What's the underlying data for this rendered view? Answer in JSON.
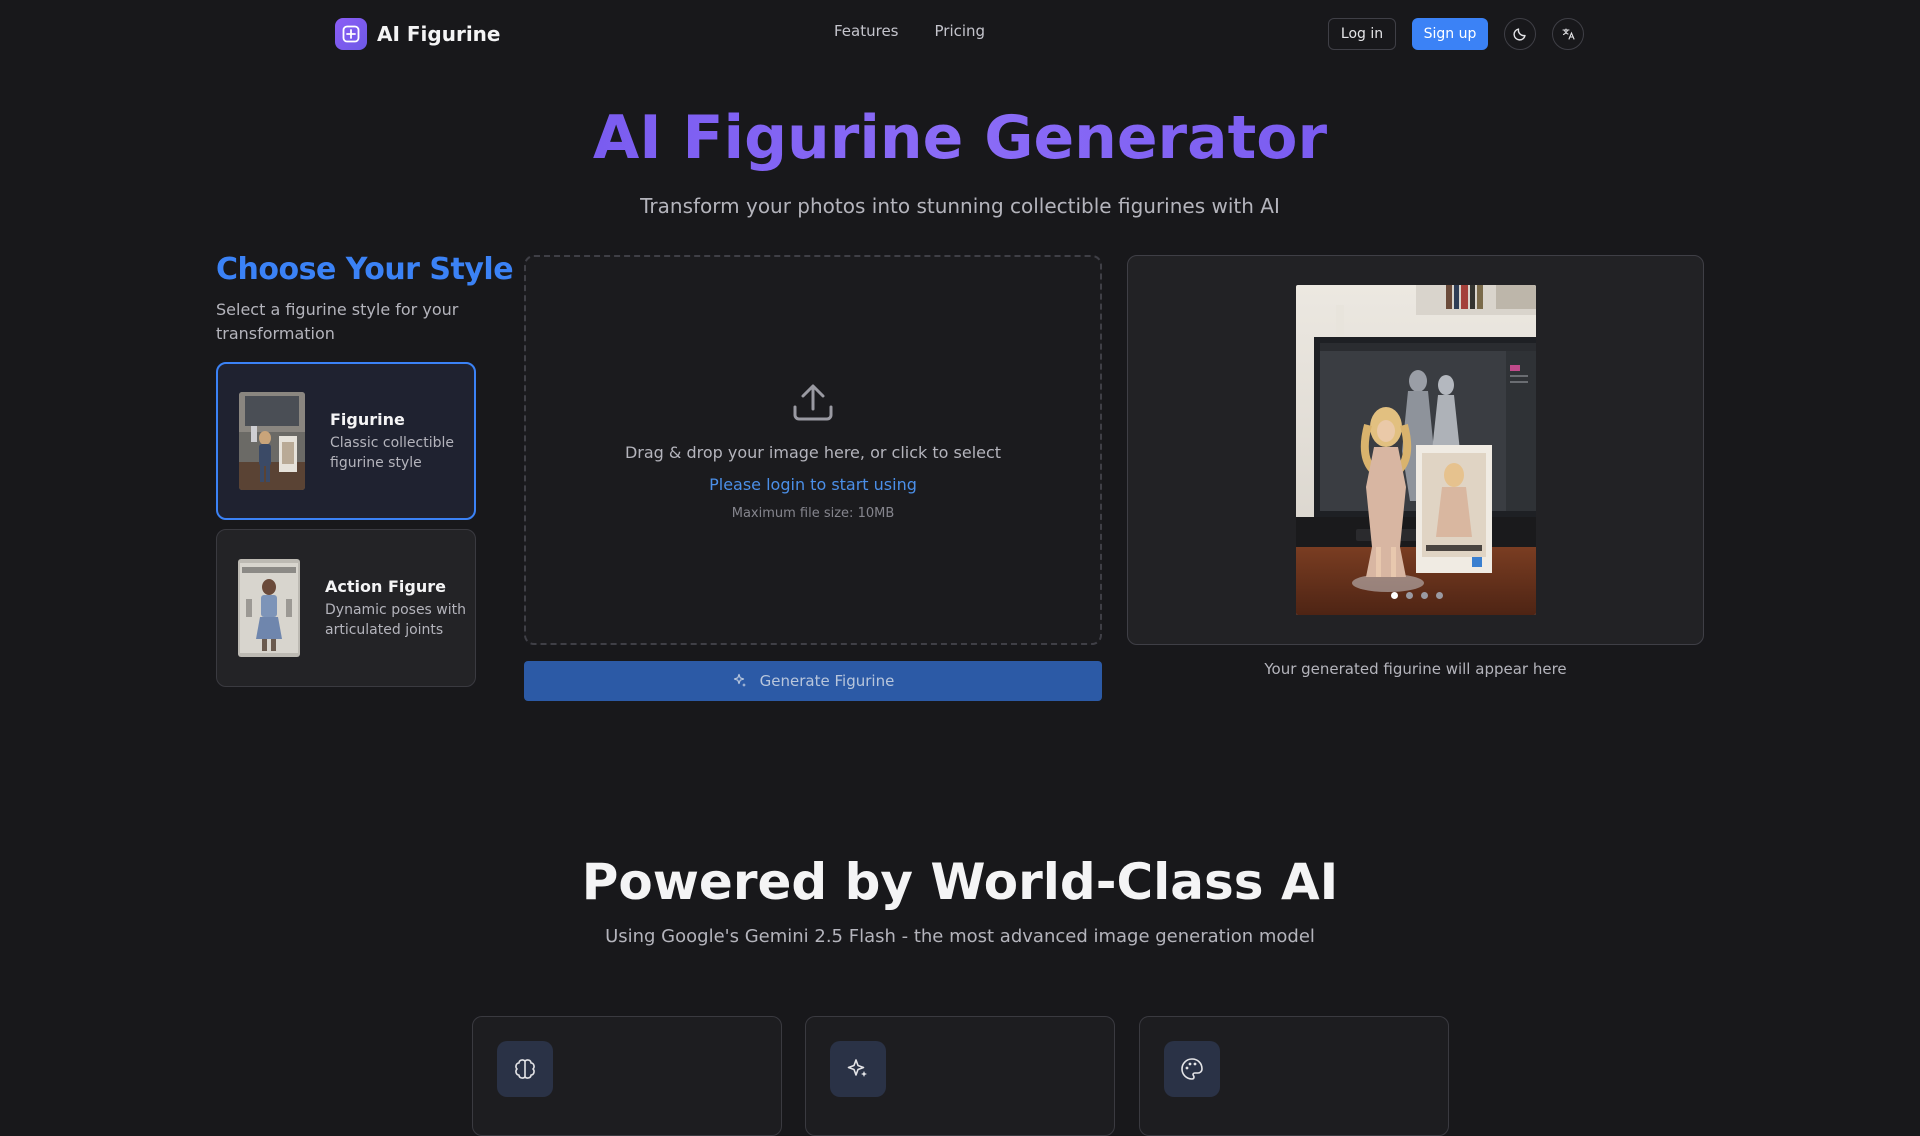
{
  "header": {
    "brand": "AI Figurine",
    "nav": [
      "Features",
      "Pricing"
    ],
    "login_label": "Log in",
    "signup_label": "Sign up",
    "theme_icon": "moon-icon",
    "language_icon": "language-icon"
  },
  "hero": {
    "title": "AI Figurine Generator",
    "subtitle": "Transform your photos into stunning collectible figurines with AI"
  },
  "styles": {
    "title": "Choose Your Style",
    "subtitle": "Select a figurine style for your transformation",
    "options": [
      {
        "name": "Figurine",
        "description": "Classic collectible figurine style",
        "selected": true
      },
      {
        "name": "Action Figure",
        "description": "Dynamic poses with articulated joints",
        "selected": false
      }
    ]
  },
  "upload": {
    "main_text": "Drag & drop your image here, or click to select",
    "login_text": "Please login to start using",
    "max_size": "Maximum file size: 10MB",
    "icon": "upload-icon"
  },
  "generate_button": "Generate Figurine",
  "preview": {
    "caption": "Your generated figurine will appear here",
    "slides": 4,
    "active_slide": 1
  },
  "powered": {
    "title": "Powered by World-Class AI",
    "subtitle": "Using Google's Gemini 2.5 Flash - the most advanced image generation model",
    "cards": [
      {
        "icon": "brain-icon"
      },
      {
        "icon": "sparkles-icon"
      },
      {
        "icon": "palette-icon"
      }
    ]
  },
  "colors": {
    "background": "#18181b",
    "accent": "#3b82f6",
    "brand_purple": "#8b5cf6"
  }
}
